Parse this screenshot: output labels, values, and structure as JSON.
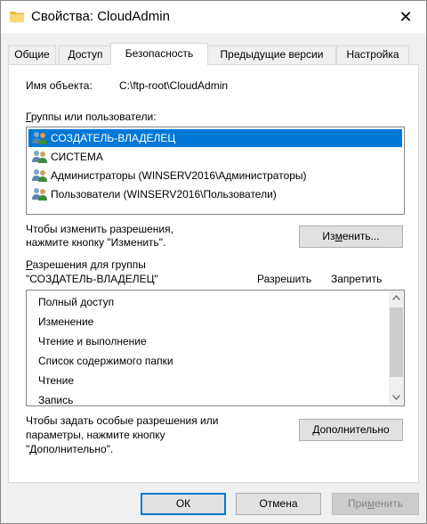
{
  "window": {
    "title": "Свойства: CloudAdmin",
    "close_glyph": "✕"
  },
  "tabs": [
    {
      "label": "Общие"
    },
    {
      "label": "Доступ"
    },
    {
      "label": "Безопасность"
    },
    {
      "label": "Предыдущие версии"
    },
    {
      "label": "Настройка"
    }
  ],
  "security": {
    "object_name_label": "Имя объекта:",
    "object_name_value": "C:\\ftp-root\\CloudAdmin",
    "groups_label_prefix": "",
    "groups_label_accel": "Г",
    "groups_label_rest": "руппы или пользователи:",
    "users": [
      {
        "name": "СОЗДАТЕЛЬ-ВЛАДЕЛЕЦ",
        "selected": true
      },
      {
        "name": "СИСТЕМА",
        "selected": false
      },
      {
        "name": "Администраторы (WINSERV2016\\Администраторы)",
        "selected": false
      },
      {
        "name": "Пользователи (WINSERV2016\\Пользователи)",
        "selected": false
      }
    ],
    "change_hint_line1": "Чтобы изменить разрешения,",
    "change_hint_line2": "нажмите кнопку \"Изменить\".",
    "change_button_pre": "Из",
    "change_button_accel": "м",
    "change_button_post": "енить...",
    "permissions_label_line1_accel": "Р",
    "permissions_label_line1_rest": "азрешения для группы",
    "permissions_label_line2": "\"СОЗДАТЕЛЬ-ВЛАДЕЛЕЦ\"",
    "allow_header": "Разрешить",
    "deny_header": "Запретить",
    "permissions": [
      "Полный доступ",
      "Изменение",
      "Чтение и выполнение",
      "Список содержимого папки",
      "Чтение",
      "Запись"
    ],
    "advanced_hint_line1": "Чтобы задать особые разрешения или",
    "advanced_hint_line2": "параметры, нажмите кнопку",
    "advanced_hint_line3": "\"Дополнительно\".",
    "advanced_button_accel": "Д",
    "advanced_button_rest": "ополнительно"
  },
  "footer": {
    "ok_label": "ОК",
    "cancel_label": "Отмена",
    "apply_pre": "При",
    "apply_accel": "м",
    "apply_post": "енить"
  },
  "colors": {
    "selection": "#0078d7",
    "window_bg": "#f0f0f0"
  }
}
